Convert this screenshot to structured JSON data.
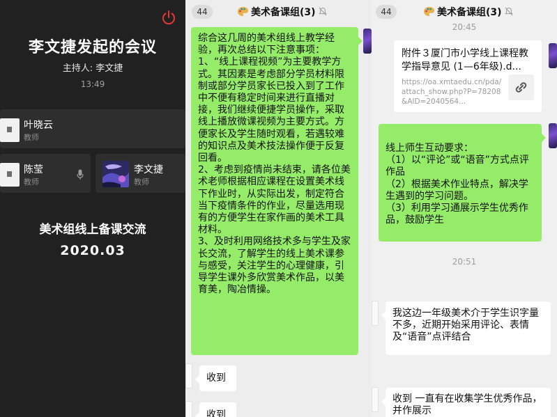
{
  "meeting": {
    "title": "李文捷发起的会议",
    "host": "主持人: 李文捷",
    "time": "13:49",
    "participants": [
      {
        "name": "叶晓云",
        "role": "教师"
      },
      {
        "name": "陈莹",
        "role": "教师"
      },
      {
        "name": "李文捷",
        "role": "教师"
      }
    ],
    "topic": "美术组线上备课交流",
    "date": "2020.03",
    "accent_color": "#e53935"
  },
  "chat_left": {
    "unread": "44",
    "group_title": "美术备课组(3)",
    "messages": [
      {
        "type": "outgoing",
        "text": "综合这几周的美术组线上教学经验，再次总结以下注意事项：\n1、“线上课程视频”为主要教学方式。其因素是考虑部分学员材料限制或部分学员家长已投入到了工作中不便有稳定时间来进行直播对接，我们继续便捷学员操作，采取线上播放微课视频为主要方式。方便家长及学生随时观看，若遇较难的知识点及美术技法操作便于反复回看。\n2、考虑到疫情尚未结束，请各位美术老师根据相应课程在设置美术线下作业时，从实际出发，制定符合当下疫情条件的作业，尽量选用现有的方便学生在家作画的美术工具材料。\n3、及时利用网络技术多与学生及家长交流，了解学生的线上美术课参与感受，关注学生的心理健康，引导学生课外多欣赏美术作品，以美育美，陶冶情操。"
      },
      {
        "type": "incoming",
        "text": "收到"
      },
      {
        "type": "incoming",
        "text": "收到"
      }
    ]
  },
  "chat_right": {
    "unread": "44",
    "group_title": "美术备课组(3)",
    "time1": "20:45",
    "file": {
      "name": "附件３厦门市小学线上课程教学指导意见 (1—6年级).d...",
      "url": "https://oa.xmtaedu.cn/pda/attach_show.php?P=78208&AID=2040564..."
    },
    "msg_interaction": "线上师生互动要求：\n（1）以“评论”或“语音”方式点评作品\n（2）根据美术作业特点，解决学生遇到的学习问题。\n（3）利用学习通展示学生优秀作品，鼓励学生",
    "time2": "20:51",
    "msg_grade1": "我这边一年级美术介于学生识字量不多，近期开始采用评论、表情及“语音”点评结合",
    "msg_collect": "收到 一直有在收集学生优秀作品，并作展示"
  },
  "colors": {
    "sent_bubble": "#95ec69",
    "received_bubble": "#ffffff",
    "chat_bg": "#ededed",
    "meeting_bg": "#212121"
  },
  "icons": [
    "power-icon",
    "microphone-icon",
    "palette-icon",
    "mute-bell-icon",
    "link-icon"
  ]
}
